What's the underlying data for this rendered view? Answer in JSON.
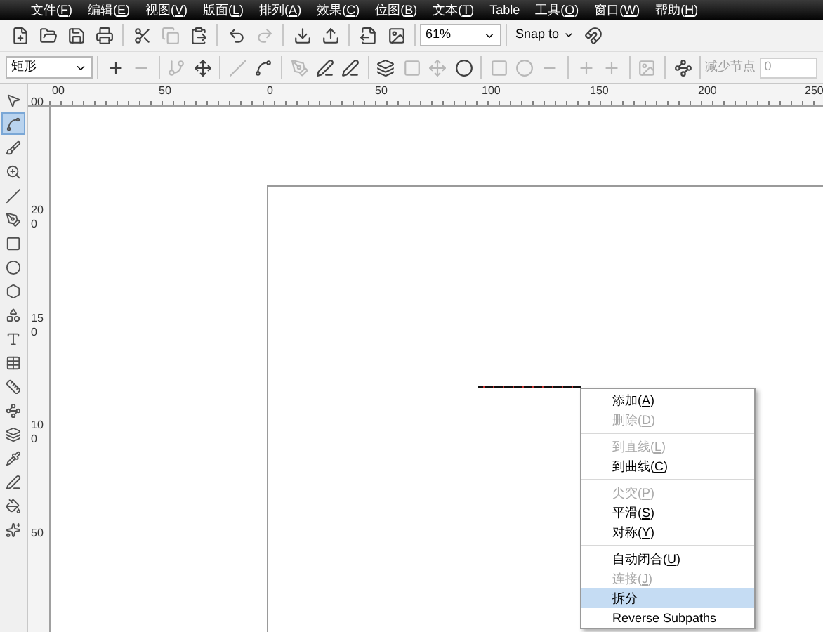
{
  "menu_bar": [
    "文件(F)",
    "编辑(E)",
    "视图(V)",
    "版面(L)",
    "排列(A)",
    "效果(C)",
    "位图(B)",
    "文本(T)",
    "Table",
    "工具(O)",
    "窗口(W)",
    "帮助(H)"
  ],
  "standard_toolbar": {
    "zoom": "61%",
    "snap": "Snap to"
  },
  "property_bar": {
    "object_type": "矩形",
    "reduce_nodes_label": "减少节点",
    "reduce_nodes_value": "0"
  },
  "toolbox": [
    {
      "kind": "pick",
      "selected": false
    },
    {
      "kind": "shape",
      "selected": true
    },
    {
      "kind": "smudge",
      "selected": false
    },
    {
      "kind": "zoom",
      "selected": false
    },
    {
      "kind": "line",
      "selected": false
    },
    {
      "kind": "artistic",
      "selected": false
    },
    {
      "kind": "rectangle",
      "selected": false
    },
    {
      "kind": "ellipse",
      "selected": false
    },
    {
      "kind": "polygon",
      "selected": false
    },
    {
      "kind": "shapes",
      "selected": false
    },
    {
      "kind": "text",
      "selected": false
    },
    {
      "kind": "table",
      "selected": false
    },
    {
      "kind": "dimension",
      "selected": false
    },
    {
      "kind": "connector",
      "selected": false
    },
    {
      "kind": "blend",
      "selected": false
    },
    {
      "kind": "eyedropper",
      "selected": false
    },
    {
      "kind": "outline",
      "selected": false
    },
    {
      "kind": "fill",
      "selected": false
    },
    {
      "kind": "interactive",
      "selected": false
    }
  ],
  "horizontal_ruler": [
    "00",
    "50",
    "0",
    "50",
    "100",
    "150",
    "200",
    "250"
  ],
  "vertical_ruler": [
    "00",
    "200",
    "150",
    "100",
    "50"
  ],
  "context_menu": [
    [
      {
        "label": "添加(A)",
        "disabled": false,
        "selected": false
      },
      {
        "label": "删除(D)",
        "disabled": true,
        "selected": false
      }
    ],
    [
      {
        "label": "到直线(L)",
        "disabled": true,
        "selected": false
      },
      {
        "label": "到曲线(C)",
        "disabled": false,
        "selected": false
      }
    ],
    [
      {
        "label": "尖突(P)",
        "disabled": true,
        "selected": false
      },
      {
        "label": "平滑(S)",
        "disabled": false,
        "selected": false
      },
      {
        "label": "对称(Y)",
        "disabled": false,
        "selected": false
      }
    ],
    [
      {
        "label": "自动闭合(U)",
        "disabled": false,
        "selected": false
      },
      {
        "label": "连接(J)",
        "disabled": true,
        "selected": false
      },
      {
        "label": "拆分",
        "disabled": false,
        "selected": true
      },
      {
        "label": "Reverse Subpaths",
        "disabled": false,
        "selected": false
      }
    ]
  ]
}
